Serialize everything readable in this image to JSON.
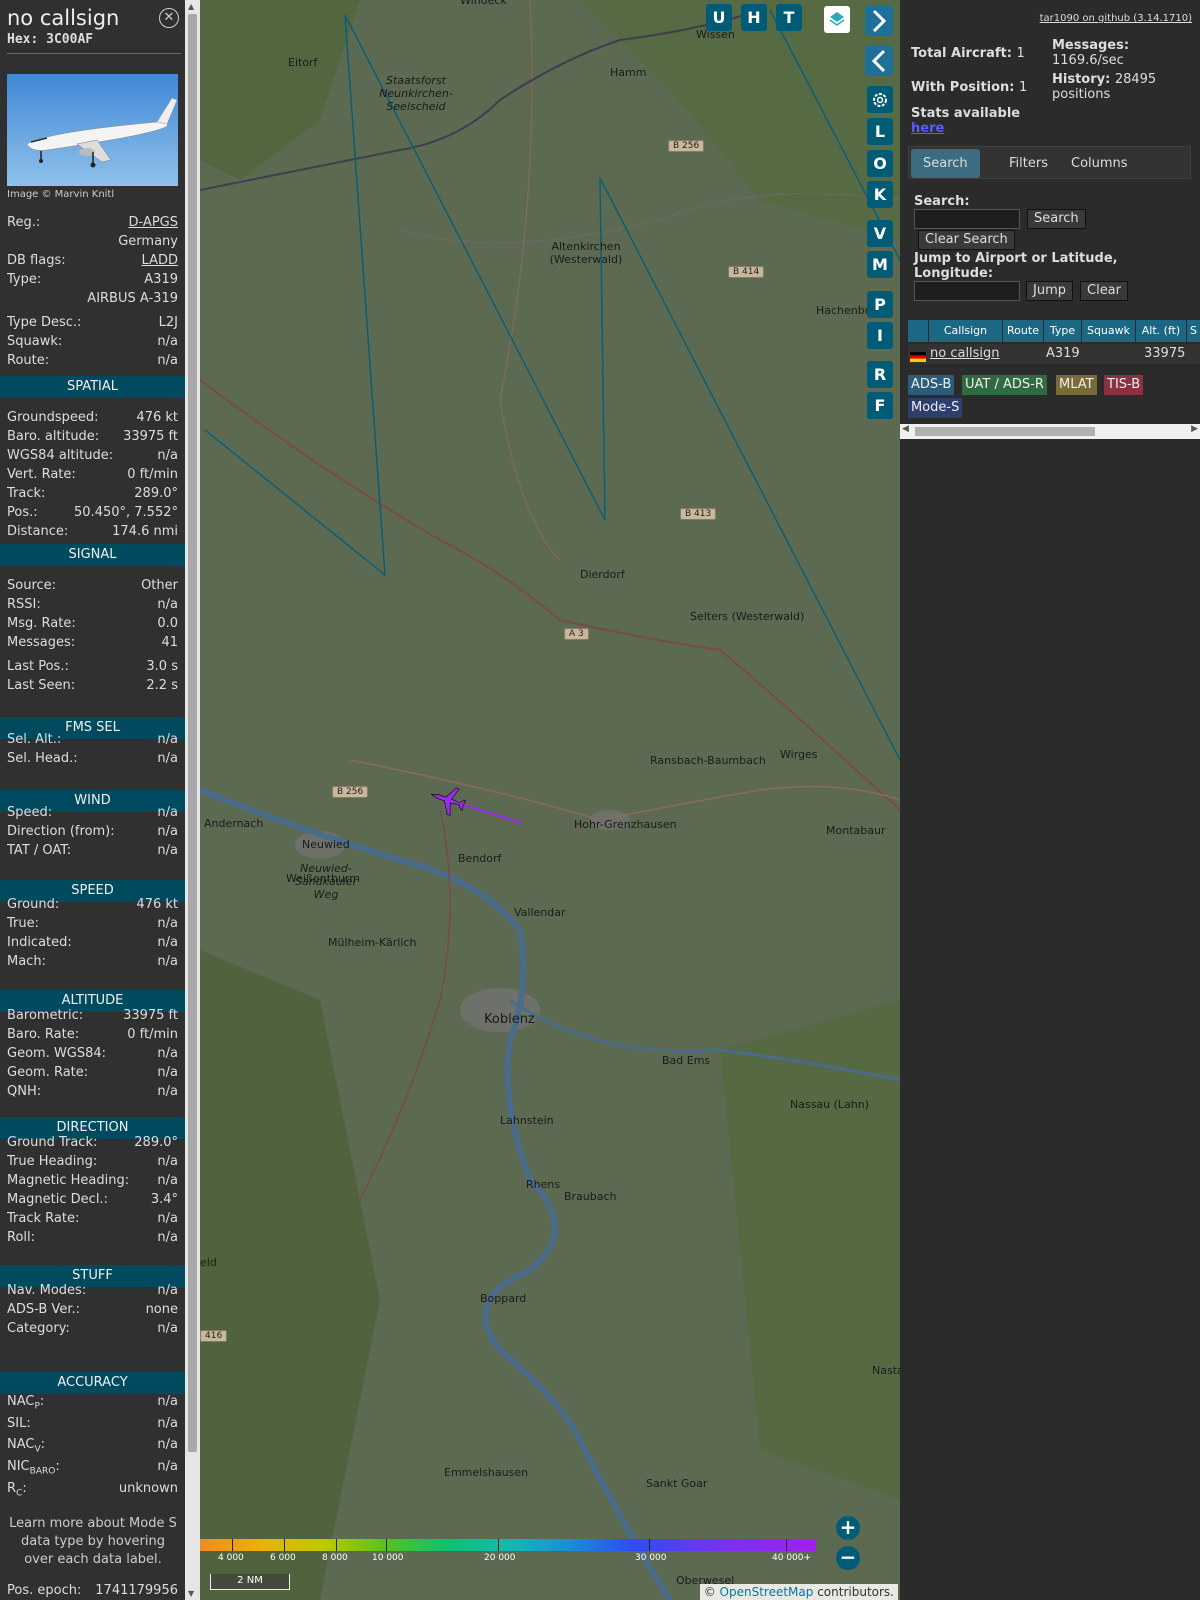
{
  "aircraft": {
    "callsign": "no callsign",
    "hex": "Hex: 3C00AF",
    "image_credit": "Image © Marvin Knitl",
    "fields": [
      {
        "label": "Reg.:",
        "value": "D-APGS",
        "link": true
      },
      {
        "label": "",
        "value": "Germany"
      },
      {
        "label": "DB flags:",
        "value": "LADD",
        "link": true
      },
      {
        "label": "Type:",
        "value": "A319"
      },
      {
        "label": "",
        "value": "AIRBUS A-319"
      },
      {
        "label": "Type Desc.:",
        "value": "L2J"
      },
      {
        "label": "Squawk:",
        "value": "n/a"
      },
      {
        "label": "Route:",
        "value": "n/a"
      }
    ]
  },
  "sections": [
    {
      "title": "SPATIAL",
      "rows": [
        {
          "label": "Groundspeed:",
          "value": "476 kt"
        },
        {
          "label": "Baro. altitude:",
          "value": "33975 ft"
        },
        {
          "label": "WGS84 altitude:",
          "value": "n/a"
        },
        {
          "label": "Vert. Rate:",
          "value": "0 ft/min"
        },
        {
          "label": "Track:",
          "value": "289.0°"
        },
        {
          "label": "Pos.:",
          "value": "50.450°, 7.552°"
        },
        {
          "label": "Distance:",
          "value": "174.6 nmi"
        }
      ]
    },
    {
      "title": "SIGNAL",
      "rows": [
        {
          "label": "Source:",
          "value": "Other"
        },
        {
          "label": "RSSI:",
          "value": "n/a"
        },
        {
          "label": "Msg. Rate:",
          "value": "0.0"
        },
        {
          "label": "Messages:",
          "value": "41"
        },
        {
          "label": "Last Pos.:",
          "value": "3.0 s"
        },
        {
          "label": "Last Seen:",
          "value": "2.2 s"
        }
      ]
    },
    {
      "title": "FMS SEL",
      "rows": [
        {
          "label": "Sel. Alt.:",
          "value": "n/a"
        },
        {
          "label": "Sel. Head.:",
          "value": "n/a"
        }
      ]
    },
    {
      "title": "WIND",
      "rows": [
        {
          "label": "Speed:",
          "value": "n/a"
        },
        {
          "label": "Direction (from):",
          "value": "n/a"
        },
        {
          "label": "TAT / OAT:",
          "value": "n/a"
        }
      ]
    },
    {
      "title": "SPEED",
      "rows": [
        {
          "label": "Ground:",
          "value": "476 kt"
        },
        {
          "label": "True:",
          "value": "n/a"
        },
        {
          "label": "Indicated:",
          "value": "n/a"
        },
        {
          "label": "Mach:",
          "value": "n/a"
        }
      ]
    },
    {
      "title": "ALTITUDE",
      "rows": [
        {
          "label": "Barometric:",
          "value": "33975 ft"
        },
        {
          "label": "Baro. Rate:",
          "value": "0 ft/min"
        },
        {
          "label": "Geom. WGS84:",
          "value": "n/a"
        },
        {
          "label": "Geom. Rate:",
          "value": "n/a"
        },
        {
          "label": "QNH:",
          "value": "n/a"
        }
      ]
    },
    {
      "title": "DIRECTION",
      "rows": [
        {
          "label": "Ground Track:",
          "value": "289.0°"
        },
        {
          "label": "True Heading:",
          "value": "n/a"
        },
        {
          "label": "Magnetic Heading:",
          "value": "n/a"
        },
        {
          "label": "Magnetic Decl.:",
          "value": "3.4°"
        },
        {
          "label": "Track Rate:",
          "value": "n/a"
        },
        {
          "label": "Roll:",
          "value": "n/a"
        }
      ]
    },
    {
      "title": "STUFF",
      "rows": [
        {
          "label": "Nav. Modes:",
          "value": "n/a"
        },
        {
          "label": "ADS-B Ver.:",
          "value": "none"
        },
        {
          "label": "Category:",
          "value": "n/a"
        }
      ]
    },
    {
      "title": "ACCURACY",
      "rows": [
        {
          "label": "NACP:",
          "label_base": "NAC",
          "label_sub": "P",
          "value": "n/a"
        },
        {
          "label": "SIL:",
          "value": "n/a"
        },
        {
          "label": "NACV:",
          "label_base": "NAC",
          "label_sub": "V",
          "value": "n/a"
        },
        {
          "label": "NICBARO:",
          "label_base": "NIC",
          "label_sub": "BARO",
          "value": "n/a"
        },
        {
          "label": "RC:",
          "label_base": "R",
          "label_sub": "C",
          "value": "unknown"
        }
      ]
    }
  ],
  "note": "Learn more about Mode S data type by hovering over each data label.",
  "epoch": {
    "label": "Pos. epoch:",
    "value": "1741179956"
  },
  "map": {
    "buttons_top": [
      "U",
      "H",
      "T"
    ],
    "buttons_side": [
      "L",
      "O",
      "K",
      "V",
      "M",
      "P",
      "I",
      "R",
      "F"
    ],
    "places": [
      {
        "name": "Windeck"
      },
      {
        "name": "Wissen"
      },
      {
        "name": "Eitorf"
      },
      {
        "name": "Hamm"
      },
      {
        "name": "Staatsforst Neunkirchen-Seelscheid"
      },
      {
        "name": "Altenkirchen (Westerwald)"
      },
      {
        "name": "Hachenbu"
      },
      {
        "name": "Dierdorf"
      },
      {
        "name": "Selters (Westerwald)"
      },
      {
        "name": "Ransbach-Baumbach"
      },
      {
        "name": "Wirges"
      },
      {
        "name": "Andernach"
      },
      {
        "name": "Neuwied"
      },
      {
        "name": "Bendorf"
      },
      {
        "name": "Hohr-Grenzhausen"
      },
      {
        "name": "Montabaur"
      },
      {
        "name": "Weißenthurm"
      },
      {
        "name": "Neuwied-Sandkauler Weg"
      },
      {
        "name": "Vallendar"
      },
      {
        "name": "Mülheim-Kärlich"
      },
      {
        "name": "Koblenz"
      },
      {
        "name": "Bad Ems"
      },
      {
        "name": "Nassau (Lahn)"
      },
      {
        "name": "Lahnstein"
      },
      {
        "name": "Rhens"
      },
      {
        "name": "Braubach"
      },
      {
        "name": "Boppard"
      },
      {
        "name": "Emmelshausen"
      },
      {
        "name": "Sankt Goar"
      },
      {
        "name": "Nasta"
      },
      {
        "name": "eld"
      },
      {
        "name": "Oberwesel"
      }
    ],
    "roads": [
      "B 256",
      "B 414",
      "B 413",
      "A 3",
      "B 256",
      "416"
    ],
    "color_scale": [
      "4 000",
      "6 000",
      "8 000",
      "10 000",
      "20 000",
      "30 000",
      "40 000+"
    ],
    "scale": "2 NM",
    "zoom_in": "+",
    "zoom_out": "−",
    "attribution_prefix": "© ",
    "attribution_link": "OpenStreetMap",
    "attribution_suffix": " contributors."
  },
  "right": {
    "github": "tar1090 on github (3.14.1710)",
    "total_label": "Total Aircraft:",
    "total_value": "1",
    "withpos_label": "With Position:",
    "withpos_value": "1",
    "messages_label": "Messages:",
    "messages_value": "1169.6/sec",
    "history_label": "History:",
    "history_value": "28495 positions",
    "stats_label": "Stats available",
    "stats_link": "here",
    "tabs": [
      "Search",
      "Filters",
      "Columns"
    ],
    "search_label": "Search:",
    "search_btn": "Search",
    "clear_search_btn": "Clear Search",
    "jump_label": "Jump to Airport or Latitude, Longitude:",
    "jump_btn": "Jump",
    "clear_btn": "Clear",
    "columns": [
      "Callsign",
      "Route",
      "Type",
      "Squawk",
      "Alt. (ft)",
      "S"
    ],
    "row": {
      "callsign": "no callsign",
      "route": "",
      "type": "A319",
      "squawk": "",
      "alt": "33975"
    },
    "badges": [
      {
        "label": "ADS-B",
        "color": "#2b5d7a"
      },
      {
        "label": "UAT / ADS-R",
        "color": "#2f6a40"
      },
      {
        "label": "MLAT",
        "color": "#7a6a3a"
      },
      {
        "label": "TIS-B",
        "color": "#8a3040"
      },
      {
        "label": "Mode-S",
        "color": "#2e3f6e"
      }
    ]
  }
}
